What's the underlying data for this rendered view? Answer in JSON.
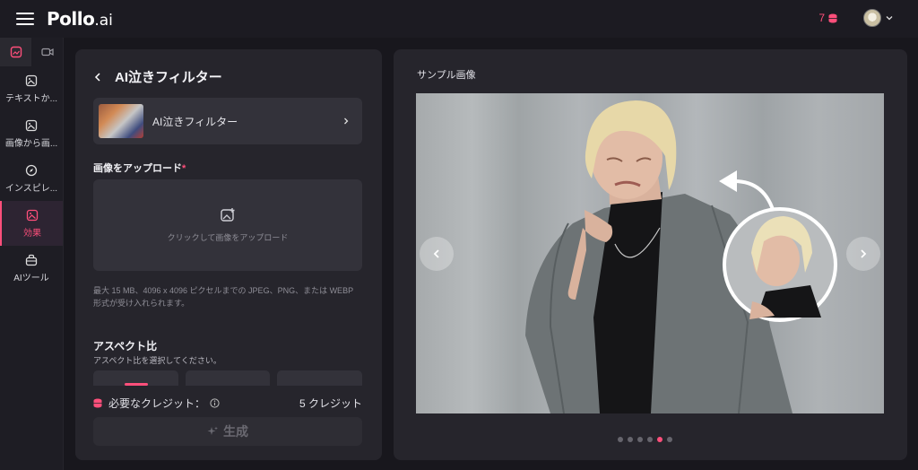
{
  "header": {
    "logo_main": "Pollo",
    "logo_suffix": ".ai",
    "credits": "7"
  },
  "sidebar": {
    "items": [
      {
        "label": "テキストか...",
        "icon": "image-sparkle-icon"
      },
      {
        "label": "画像から画...",
        "icon": "image-sparkle-icon"
      },
      {
        "label": "インスピレ...",
        "icon": "compass-icon"
      },
      {
        "label": "効果",
        "icon": "effects-icon"
      },
      {
        "label": "AIツール",
        "icon": "toolbox-icon"
      }
    ]
  },
  "panel": {
    "title": "AI泣きフィルター",
    "effect_name": "AI泣きフィルター",
    "upload_label": "画像をアップロード",
    "required_mark": "*",
    "dropzone_text": "クリックして画像をアップロード",
    "hint": "最大 15 MB、4096 x 4096 ピクセルまでの JPEG、PNG、または WEBP 形式が受け入れられます。",
    "aspect_title": "アスペクト比",
    "aspect_subtitle": "アスペクト比を選択してください。",
    "credits_label": "必要なクレジット：",
    "credits_amount": "5 クレジット",
    "generate_label": "生成"
  },
  "preview": {
    "title": "サンプル画像",
    "dots_count": 6,
    "active_dot": 4
  },
  "colors": {
    "accent": "#ff4f7b",
    "background": "#18171d",
    "panel": "#26252c",
    "card": "#33323a"
  }
}
